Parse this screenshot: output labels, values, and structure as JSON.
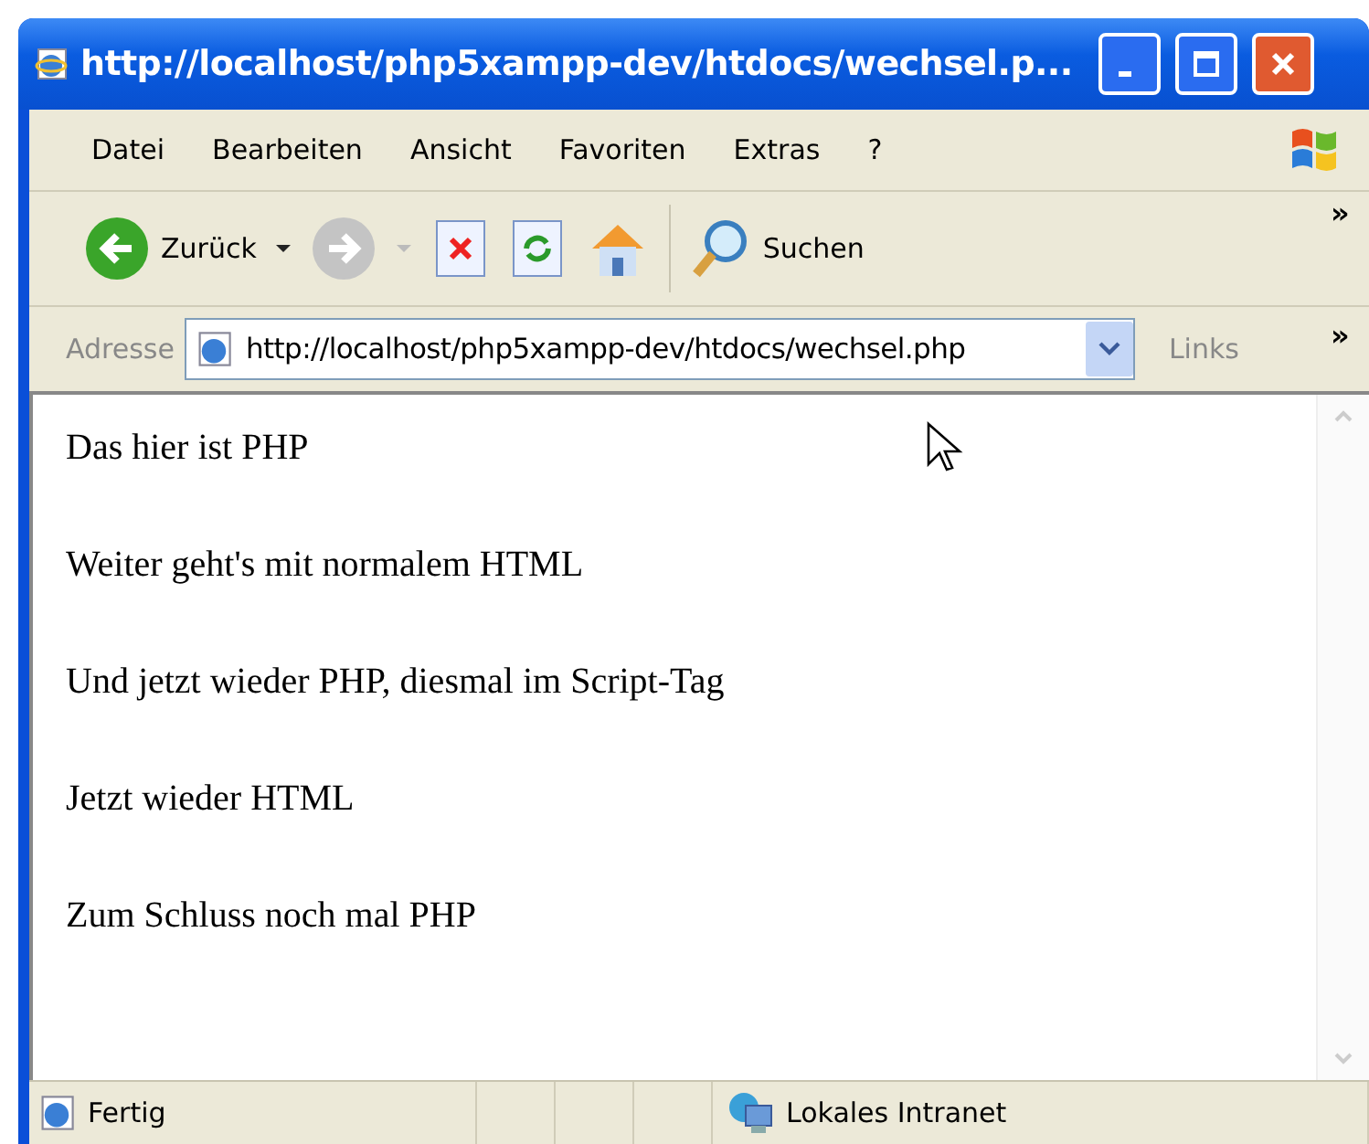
{
  "window": {
    "title": "http://localhost/php5xampp-dev/htdocs/wechsel.p..."
  },
  "menu": [
    "Datei",
    "Bearbeiten",
    "Ansicht",
    "Favoriten",
    "Extras",
    "?"
  ],
  "toolbar": {
    "back": "Zurück",
    "search": "Suchen",
    "more": "»"
  },
  "address": {
    "label": "Adresse",
    "value": "http://localhost/php5xampp-dev/htdocs/wechsel.php",
    "links": "Links",
    "more": "»"
  },
  "content": [
    "Das hier ist PHP",
    "Weiter geht's mit normalem HTML",
    "Und jetzt wieder PHP, diesmal im Script-Tag",
    "Jetzt wieder HTML",
    "Zum Schluss noch mal PHP"
  ],
  "status_bar": {
    "status": "Fertig",
    "zone": "Lokales Intranet"
  }
}
